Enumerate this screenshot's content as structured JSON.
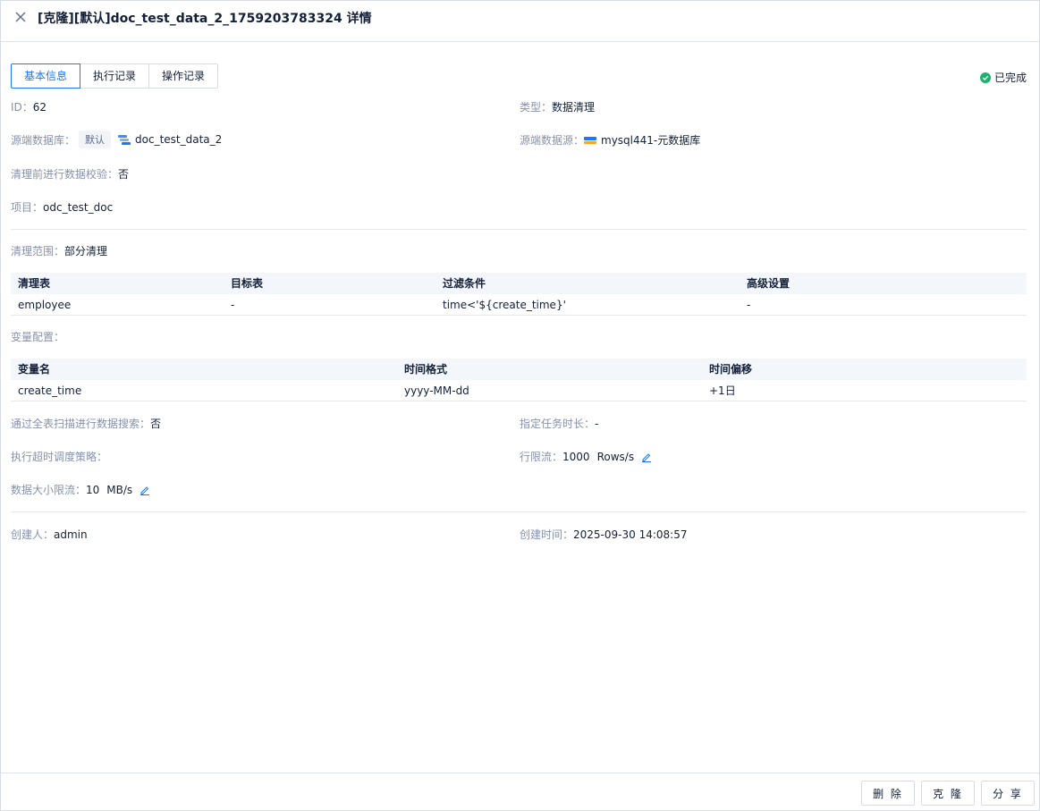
{
  "header": {
    "title": "[克隆][默认]doc_test_data_2_1759203783324 详情"
  },
  "tabs": [
    {
      "label": "基本信息",
      "active": true
    },
    {
      "label": "执行记录",
      "active": false
    },
    {
      "label": "操作记录",
      "active": false
    }
  ],
  "status": {
    "label": "已完成",
    "color": "#19b36b"
  },
  "info": {
    "id_label": "ID：",
    "id_value": "62",
    "type_label": "类型：",
    "type_value": "数据清理",
    "src_db_label": "源端数据库：",
    "src_db_tag": "默认",
    "src_db_value": "doc_test_data_2",
    "src_ds_label": "源端数据源：",
    "src_ds_value": "mysql441-元数据库",
    "verify_label": "清理前进行数据校验：",
    "verify_value": "否",
    "project_label": "项目：",
    "project_value": "odc_test_doc",
    "scope_label": "清理范围：",
    "scope_value": "部分清理"
  },
  "clean_table": {
    "headers": [
      "清理表",
      "目标表",
      "过滤条件",
      "高级设置"
    ],
    "rows": [
      [
        "employee",
        "-",
        "time<'${create_time}'",
        "-"
      ]
    ]
  },
  "var_label": "变量配置：",
  "var_table": {
    "headers": [
      "变量名",
      "时间格式",
      "时间偏移"
    ],
    "rows": [
      [
        "create_time",
        "yyyy-MM-dd",
        "+1日"
      ]
    ]
  },
  "settings": {
    "fullscan_label": "通过全表扫描进行数据搜索：",
    "fullscan_value": "否",
    "duration_label": "指定任务时长：",
    "duration_value": "-",
    "timeout_label": "执行超时调度策略：",
    "timeout_value": "",
    "rowlimit_label": "行限流：",
    "rowlimit_value": "1000",
    "rowlimit_unit": "Rows/s",
    "datalimit_label": "数据大小限流：",
    "datalimit_value": "10",
    "datalimit_unit": "MB/s"
  },
  "meta": {
    "creator_label": "创建人：",
    "creator_value": "admin",
    "created_label": "创建时间：",
    "created_value": "2025-09-30 14:08:57"
  },
  "footer": {
    "delete_label": "删 除",
    "clone_label": "克 隆",
    "share_label": "分 享"
  },
  "colors": {
    "accent": "#1677ff",
    "label": "#8592ad",
    "text": "#132039"
  }
}
